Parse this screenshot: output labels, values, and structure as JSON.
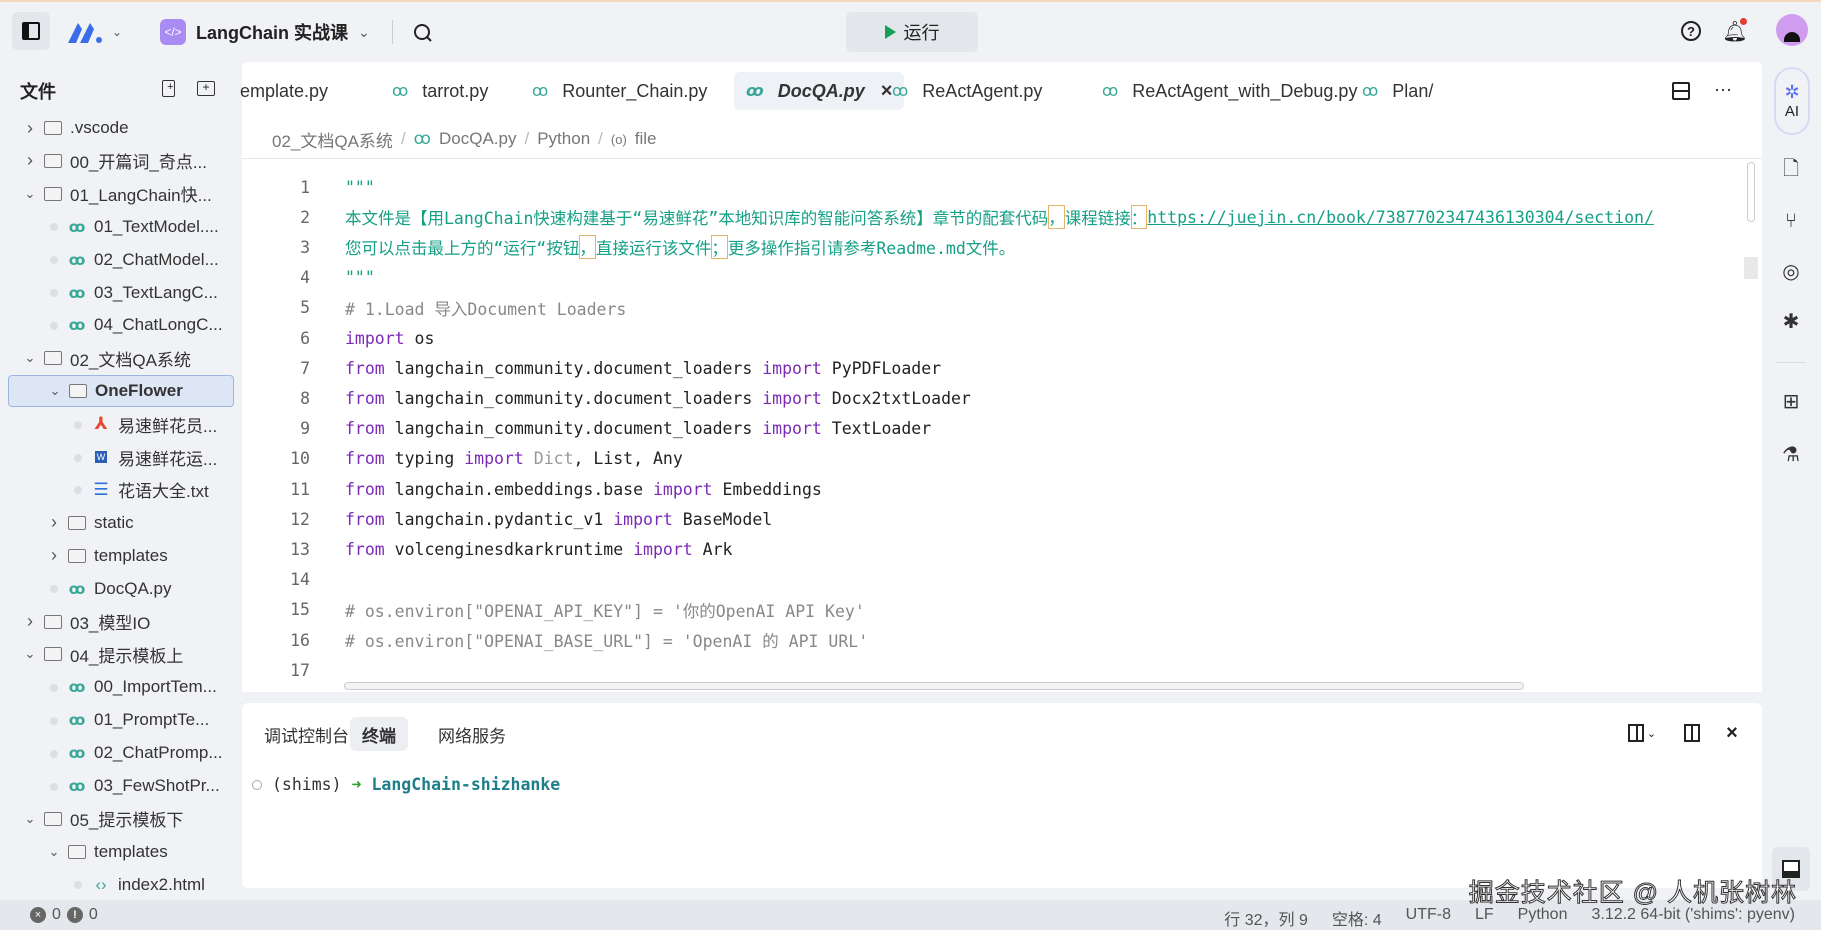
{
  "topbar": {
    "project": "LangChain 实战课",
    "run_label": "运行",
    "colors": {
      "run": "#18a058",
      "accent": "#a17cf0"
    }
  },
  "sidebar": {
    "title": "文件",
    "items": [
      {
        "level": 0,
        "kind": "folder",
        "open": false,
        "label": ".vscode"
      },
      {
        "level": 0,
        "kind": "folder",
        "open": false,
        "label": "00_开篇词_奇点..."
      },
      {
        "level": 0,
        "kind": "folder",
        "open": true,
        "label": "01_LangChain快..."
      },
      {
        "level": 1,
        "kind": "py",
        "label": "01_TextModel...."
      },
      {
        "level": 1,
        "kind": "py",
        "label": "02_ChatModel..."
      },
      {
        "level": 1,
        "kind": "py",
        "label": "03_TextLangC..."
      },
      {
        "level": 1,
        "kind": "py",
        "label": "04_ChatLongC..."
      },
      {
        "level": 0,
        "kind": "folder",
        "open": true,
        "label": "02_文档QA系统"
      },
      {
        "level": 1,
        "kind": "folder",
        "open": true,
        "label": "OneFlower",
        "selected": true
      },
      {
        "level": 2,
        "kind": "pdf",
        "label": "易速鲜花员..."
      },
      {
        "level": 2,
        "kind": "doc",
        "label": "易速鲜花运..."
      },
      {
        "level": 2,
        "kind": "txt",
        "label": "花语大全.txt"
      },
      {
        "level": 1,
        "kind": "folder",
        "open": false,
        "label": "static"
      },
      {
        "level": 1,
        "kind": "folder",
        "open": false,
        "label": "templates"
      },
      {
        "level": 1,
        "kind": "py",
        "label": "DocQA.py"
      },
      {
        "level": 0,
        "kind": "folder",
        "open": false,
        "label": "03_模型IO"
      },
      {
        "level": 0,
        "kind": "folder",
        "open": true,
        "label": "04_提示模板上"
      },
      {
        "level": 1,
        "kind": "py",
        "label": "00_ImportTem..."
      },
      {
        "level": 1,
        "kind": "py",
        "label": "01_PromptTe..."
      },
      {
        "level": 1,
        "kind": "py",
        "label": "02_ChatPromp..."
      },
      {
        "level": 1,
        "kind": "py",
        "label": "03_FewShotPr..."
      },
      {
        "level": 0,
        "kind": "folder",
        "open": true,
        "label": "05_提示模板下"
      },
      {
        "level": 1,
        "kind": "folder",
        "open": true,
        "label": "templates"
      },
      {
        "level": 2,
        "kind": "html",
        "label": "index2.html"
      }
    ]
  },
  "tabs": [
    {
      "label": "emplate.py"
    },
    {
      "label": "tarrot.py"
    },
    {
      "label": "Rounter_Chain.py"
    },
    {
      "label": "DocQA.py",
      "active": true
    },
    {
      "label": "ReActAgent.py"
    },
    {
      "label": "ReActAgent_with_Debug.py"
    },
    {
      "label": "Plan/"
    }
  ],
  "breadcrumb": [
    "02_文档QA系统",
    "DocQA.py",
    "Python",
    "file"
  ],
  "code": [
    {
      "n": "1",
      "t": [
        [
          "\"\"\"",
          "st"
        ]
      ]
    },
    {
      "n": "2",
      "t": [
        [
          "本文件是【用LangChain快速构建基于“易速鲜花”本地知识库的智能问答系统】章节的配套代码",
          "st"
        ],
        [
          "，",
          "st hl"
        ],
        [
          "课程链接",
          "st"
        ],
        [
          "：",
          "st hl"
        ],
        [
          "https://juejin.cn/book/7387702347436130304/section/",
          "lk"
        ]
      ]
    },
    {
      "n": "3",
      "t": [
        [
          "您可以点击最上方的“运行“按钮",
          "st"
        ],
        [
          "，",
          "st hl"
        ],
        [
          "直接运行该文件",
          "st"
        ],
        [
          "；",
          "st hl"
        ],
        [
          "更多操作指引请参考Readme.md文件。",
          "st"
        ]
      ]
    },
    {
      "n": "4",
      "t": [
        [
          "\"\"\"",
          "st"
        ]
      ]
    },
    {
      "n": "5",
      "t": [
        [
          "# 1.Load 导入Document Loaders",
          "cm"
        ]
      ]
    },
    {
      "n": "6",
      "t": [
        [
          "import",
          "kw"
        ],
        [
          " os",
          "tx"
        ]
      ]
    },
    {
      "n": "7",
      "t": [
        [
          "from",
          "kw"
        ],
        [
          " langchain_community.document_loaders ",
          "tx"
        ],
        [
          "import",
          "kw"
        ],
        [
          " PyPDFLoader",
          "tx"
        ]
      ]
    },
    {
      "n": "8",
      "t": [
        [
          "from",
          "kw"
        ],
        [
          " langchain_community.document_loaders ",
          "tx"
        ],
        [
          "import",
          "kw"
        ],
        [
          " Docx2txtLoader",
          "tx"
        ]
      ]
    },
    {
      "n": "9",
      "t": [
        [
          "from",
          "kw"
        ],
        [
          " langchain_community.document_loaders ",
          "tx"
        ],
        [
          "import",
          "kw"
        ],
        [
          " TextLoader",
          "tx"
        ]
      ]
    },
    {
      "n": "10",
      "t": [
        [
          "from",
          "kw"
        ],
        [
          " typing ",
          "tx"
        ],
        [
          "import",
          "kw"
        ],
        [
          " Dict",
          "dim"
        ],
        [
          ", List, Any",
          "tx"
        ]
      ]
    },
    {
      "n": "11",
      "t": [
        [
          "from",
          "kw"
        ],
        [
          " langchain.embeddings.base ",
          "tx"
        ],
        [
          "import",
          "kw"
        ],
        [
          " Embeddings",
          "tx"
        ]
      ]
    },
    {
      "n": "12",
      "t": [
        [
          "from",
          "kw"
        ],
        [
          " langchain.pydantic_v1 ",
          "tx"
        ],
        [
          "import",
          "kw"
        ],
        [
          " BaseModel",
          "tx"
        ]
      ]
    },
    {
      "n": "13",
      "t": [
        [
          "from",
          "kw"
        ],
        [
          " volcenginesdkarkruntime ",
          "tx"
        ],
        [
          "import",
          "kw"
        ],
        [
          " Ark",
          "tx"
        ]
      ]
    },
    {
      "n": "14",
      "t": []
    },
    {
      "n": "15",
      "t": [
        [
          "# os.environ[\"OPENAI_API_KEY\"] = '你的OpenAI API Key'",
          "cm"
        ]
      ]
    },
    {
      "n": "16",
      "t": [
        [
          "# os.environ[\"OPENAI_BASE_URL\"] = 'OpenAI 的 API URL'",
          "cm"
        ]
      ]
    },
    {
      "n": "17",
      "t": []
    }
  ],
  "panel": {
    "tabs": [
      {
        "label": "调试控制台"
      },
      {
        "label": "终端",
        "active": true
      },
      {
        "label": "网络服务"
      }
    ],
    "terminal": {
      "env": "(shims)",
      "arrow": "➜",
      "dir": "LangChain-shizhanke"
    }
  },
  "right_bar": {
    "ai_label": "AI"
  },
  "status": {
    "errors": "0",
    "warnings": "0",
    "position": "行 32，列 9",
    "spaces": "空格: 4",
    "encoding": "UTF-8",
    "eol": "LF",
    "language": "Python",
    "interpreter": "3.12.2 64-bit ('shims': pyenv)"
  },
  "watermark": "掘金技术社区 @ 人机张树林"
}
